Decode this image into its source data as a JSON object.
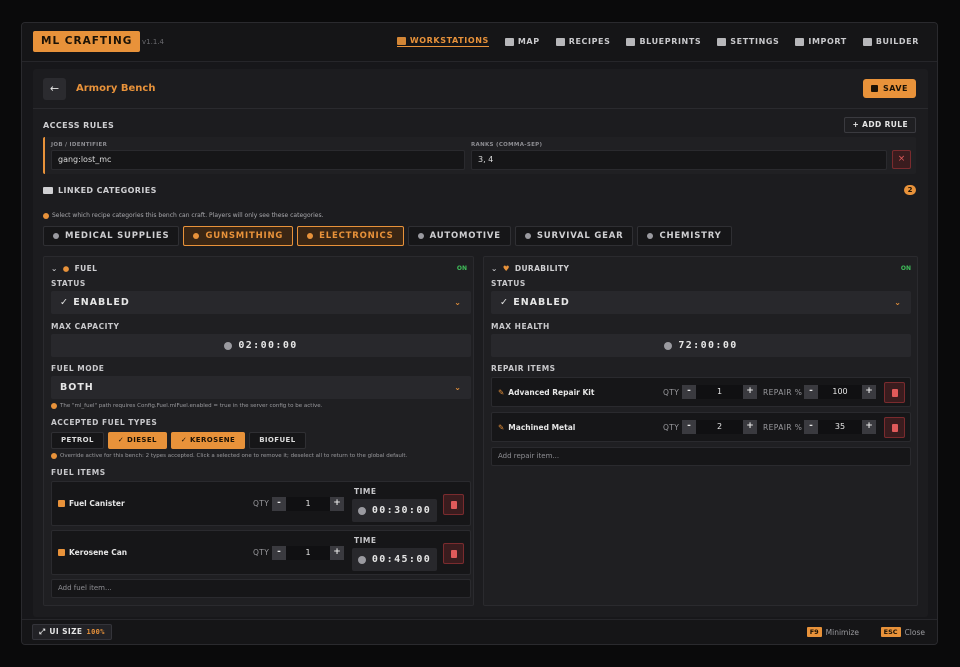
{
  "app": {
    "logo": "ML CRAFTING",
    "version": "v1.1.4"
  },
  "nav": [
    {
      "label": "WORKSTATIONS",
      "icon": "workstation-icon"
    },
    {
      "label": "MAP",
      "icon": "map-icon"
    },
    {
      "label": "RECIPES",
      "icon": "flask-icon"
    },
    {
      "label": "BLUEPRINTS",
      "icon": "scroll-icon"
    },
    {
      "label": "SETTINGS",
      "icon": "gear-icon"
    },
    {
      "label": "IMPORT",
      "icon": "import-icon"
    },
    {
      "label": "BUILDER",
      "icon": "cube-icon"
    }
  ],
  "bench": {
    "title": "Armory Bench",
    "save": "SAVE"
  },
  "access": {
    "label": "ACCESS RULES",
    "add": "+ ADD RULE",
    "job_label": "JOB / IDENTIFIER",
    "job_value": "gang:lost_mc",
    "ranks_label": "RANKS (COMMA-SEP)",
    "ranks_value": "3, 4",
    "remove": "×"
  },
  "linked": {
    "label": "LINKED CATEGORIES",
    "count": "2",
    "hint": "Select which recipe categories this bench can craft. Players will only see these categories.",
    "chips": [
      {
        "label": "MEDICAL SUPPLIES",
        "on": false
      },
      {
        "label": "GUNSMITHING",
        "on": true
      },
      {
        "label": "ELECTRONICS",
        "on": true
      },
      {
        "label": "AUTOMOTIVE",
        "on": false
      },
      {
        "label": "SURVIVAL GEAR",
        "on": false
      },
      {
        "label": "CHEMISTRY",
        "on": false
      }
    ]
  },
  "fuel": {
    "title": "FUEL",
    "state": "ON",
    "status_label": "STATUS",
    "status": "✓  ENABLED",
    "cap_label": "MAX CAPACITY",
    "cap": "02:00:00",
    "mode_label": "FUEL MODE",
    "mode": "BOTH",
    "mode_note": "The \"ml_fuel\" path requires Config.Fuel.mlFuel.enabled = true in the server config to be active.",
    "types_label": "ACCEPTED FUEL TYPES",
    "types": [
      {
        "label": "PETROL",
        "on": false
      },
      {
        "label": "✓  DIESEL",
        "on": true
      },
      {
        "label": "✓  KEROSENE",
        "on": true
      },
      {
        "label": "BIOFUEL",
        "on": false
      }
    ],
    "types_note": "Override active for this bench: 2 types accepted. Click a selected one to remove it; deselect all to return to the global default.",
    "items_label": "FUEL ITEMS",
    "qty_label": "QTY",
    "time_label": "TIME",
    "items": [
      {
        "name": "Fuel Canister",
        "qty": "1",
        "time": "00:30:00"
      },
      {
        "name": "Kerosene Can",
        "qty": "1",
        "time": "00:45:00"
      }
    ],
    "add_placeholder": "Add fuel item..."
  },
  "durability": {
    "title": "DURABILITY",
    "state": "ON",
    "status_label": "STATUS",
    "status": "✓  ENABLED",
    "health_label": "MAX HEALTH",
    "health": "72:00:00",
    "repair_label": "REPAIR ITEMS",
    "qty_label": "QTY",
    "repair_pct_label": "REPAIR %",
    "items": [
      {
        "name": "Advanced Repair Kit",
        "qty": "1",
        "pct": "100"
      },
      {
        "name": "Machined Metal",
        "qty": "2",
        "pct": "35"
      }
    ],
    "add_placeholder": "Add repair item..."
  },
  "footer": {
    "ui_size_label": "UI SIZE",
    "ui_size": "100%",
    "min_key": "F9",
    "min_label": "Minimize",
    "close_key": "ESC",
    "close_label": "Close"
  }
}
